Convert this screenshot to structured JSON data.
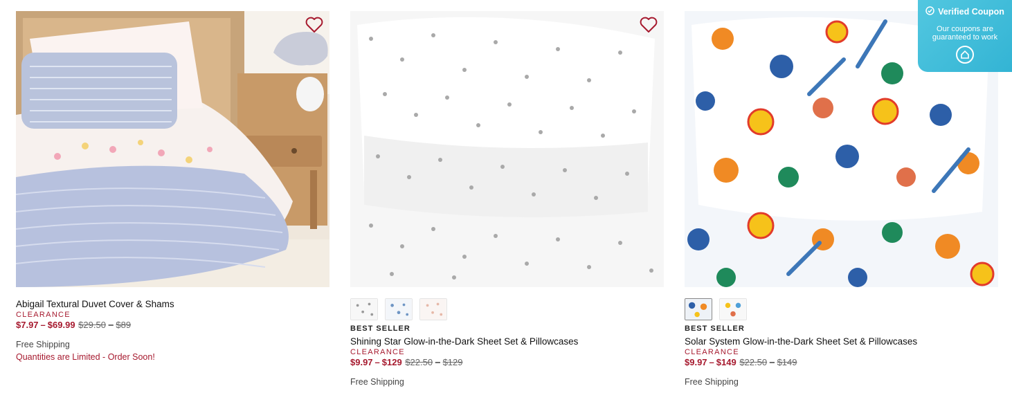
{
  "products": [
    {
      "title": "Abigail Textural Duvet Cover & Shams",
      "clearance": "CLEARANCE",
      "price_low": "$7.97",
      "dash": "–",
      "price_high": "$69.99",
      "orig_low": "$29.50",
      "orig_sep": "–",
      "orig_high": "$89",
      "shipping": "Free Shipping",
      "notice": "Quantities are Limited - Order Soon!"
    },
    {
      "badge": "BEST SELLER",
      "title": "Shining Star Glow-in-the-Dark Sheet Set & Pillowcases",
      "clearance": "CLEARANCE",
      "price_low": "$9.97",
      "dash": "–",
      "price_high": "$129",
      "orig_low": "$22.50",
      "orig_sep": "–",
      "orig_high": "$129",
      "shipping": "Free Shipping"
    },
    {
      "badge": "BEST SELLER",
      "title": "Solar System Glow-in-the-Dark Sheet Set & Pillowcases",
      "clearance": "CLEARANCE",
      "price_low": "$9.97",
      "dash": "–",
      "price_high": "$149",
      "orig_low": "$22.50",
      "orig_sep": "–",
      "orig_high": "$149",
      "shipping": "Free Shipping"
    }
  ],
  "coupon": {
    "title": "Verified Coupon",
    "subtitle": "Our coupons are guaranteed to work"
  },
  "colors": {
    "sale": "#a6192e",
    "coupon_bg": "#3fbcd9",
    "heart": "#a6192e"
  }
}
